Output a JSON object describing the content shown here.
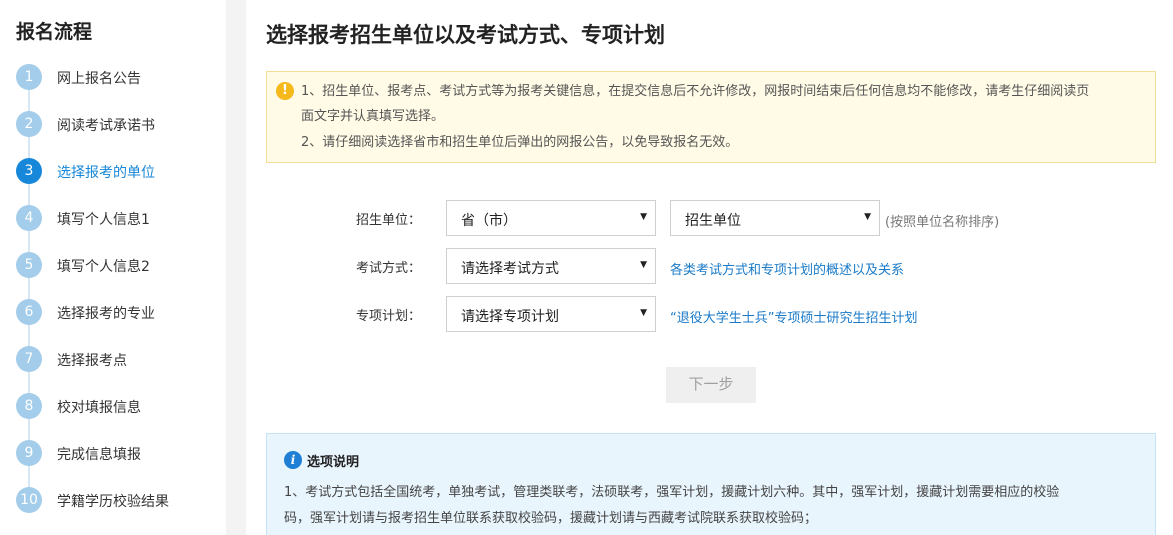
{
  "sidebar": {
    "title": "报名流程",
    "steps": [
      {
        "num": "1",
        "label": "网上报名公告"
      },
      {
        "num": "2",
        "label": "阅读考试承诺书"
      },
      {
        "num": "3",
        "label": "选择报考的单位"
      },
      {
        "num": "4",
        "label": "填写个人信息1"
      },
      {
        "num": "5",
        "label": "填写个人信息2"
      },
      {
        "num": "6",
        "label": "选择报考的专业"
      },
      {
        "num": "7",
        "label": "选择报考点"
      },
      {
        "num": "8",
        "label": "校对填报信息"
      },
      {
        "num": "9",
        "label": "完成信息填报"
      },
      {
        "num": "10",
        "label": "学籍学历校验结果"
      }
    ],
    "active_step": "3"
  },
  "main": {
    "title": "选择报考招生单位以及考试方式、专项计划",
    "notice": {
      "line1a": "1、招生单位、报考点、考试方式等为报考关键信息，在提交信息后不允许修改，网报时间结束后任何信息均不能修改，请考生仔细阅读页",
      "line1b": "面文字并认真填写选择。",
      "line2": "2、请仔细阅读选择省市和招生单位后弹出的网报公告，以免导致报名无效。"
    },
    "form": {
      "unit_label": "招生单位：",
      "province_value": "省（市）",
      "unit_value": "招生单位",
      "unit_hint": "(按照单位名称排序)",
      "exam_label": "考试方式：",
      "exam_value": "请选择考试方式",
      "exam_link": "各类考试方式和专项计划的概述以及关系",
      "plan_label": "专项计划：",
      "plan_value": "请选择专项计划",
      "plan_link": "“退役大学生士兵”专项硕士研究生招生计划"
    },
    "next_button": "下一步",
    "options": {
      "title": "选项说明",
      "line1a": "1、考试方式包括全国统考，单独考试，管理类联考，法硕联考，强军计划，援藏计划六种。其中，强军计划，援藏计划需要相应的校验",
      "line1b": "码，强军计划请与报考招生单位联系获取校验码，援藏计划请与西藏考试院联系获取校验码；"
    }
  },
  "colors": {
    "accent": "#1787d9",
    "step_inactive": "#a3cdea",
    "notice_bg": "#fffbe6",
    "options_bg": "#e9f5fd",
    "link": "#1a7ac8"
  }
}
